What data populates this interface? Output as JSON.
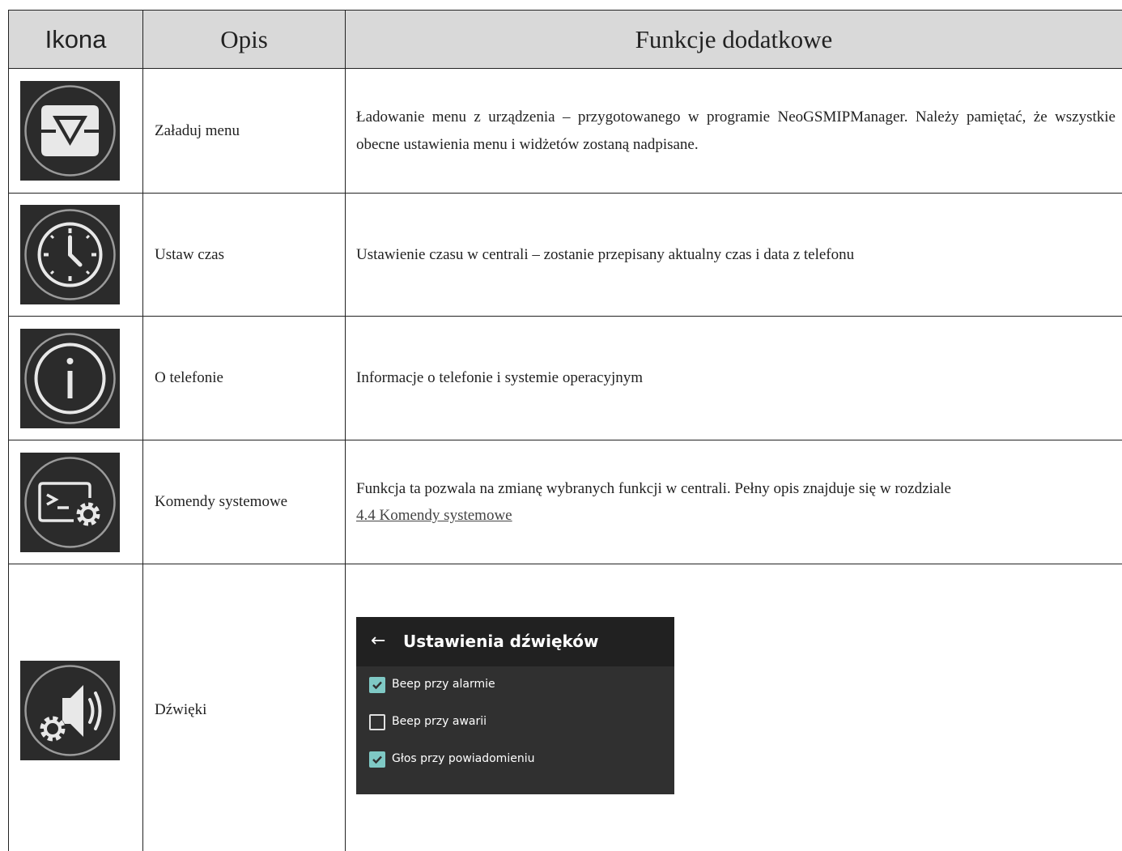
{
  "table": {
    "headers": {
      "icon": "Ikona",
      "description": "Opis",
      "function": "Funkcje dodatkowe"
    },
    "rows": [
      {
        "icon": "load-menu-icon",
        "label": "Załaduj menu",
        "text": "Ładowanie menu z urządzenia – przygotowanego w programie NeoGSMIPManager. Należy pamiętać, że wszystkie obecne ustawienia menu i widżetów zostaną nadpisane."
      },
      {
        "icon": "clock-icon",
        "label": "Ustaw czas",
        "text": "Ustawienie czasu w centrali – zostanie przepisany aktualny czas i data z telefonu"
      },
      {
        "icon": "info-icon",
        "label": "O telefonie",
        "text": "Informacje o telefonie i systemie operacyjnym"
      },
      {
        "icon": "terminal-gear-icon",
        "label": "Komendy systemowe",
        "text": "Funkcja ta pozwala na zmianę wybranych funkcji w centrali. Pełny opis znajduje się w rozdziale",
        "link": "4.4 Komendy systemowe"
      },
      {
        "icon": "speaker-gear-icon",
        "label": "Dźwięki"
      }
    ]
  },
  "sound_settings": {
    "back_icon": "arrow-left-icon",
    "title": "Ustawienia dźwięków",
    "accent_color": "#7fc9c5",
    "options": [
      {
        "label": "Beep przy alarmie",
        "checked": true
      },
      {
        "label": "Beep przy awarii",
        "checked": false
      },
      {
        "label": "Głos przy powiadomieniu",
        "checked": true
      }
    ]
  }
}
